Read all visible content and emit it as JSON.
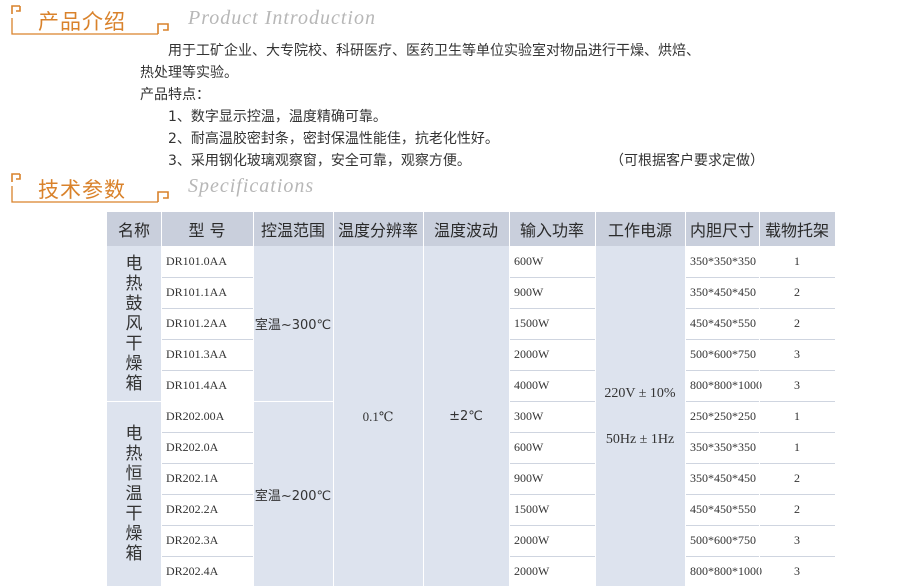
{
  "intro_section": {
    "title_cn": "产品介绍",
    "title_en": "Product Introduction",
    "lines": [
      "用于工矿企业、大专院校、科研医疗、医药卫生等单位实验室对物品进行干燥、烘焙、",
      "热处理等实验。",
      "产品特点：",
      "1、数字显示控温，温度精确可靠。",
      "2、耐高温胶密封条，密封保温性能佳，抗老化性好。",
      "3、采用钢化玻璃观察窗，安全可靠，观察方便。"
    ],
    "custom_note": "（可根据客户要求定做）"
  },
  "spec_section": {
    "title_cn": "技术参数",
    "title_en": "Specifications"
  },
  "table": {
    "headers": [
      "名称",
      "型 号",
      "控温范围",
      "温度分辨率",
      "温度波动",
      "输入功率",
      "工作电源",
      "内胆尺寸",
      "载物托架"
    ],
    "groups": [
      {
        "name": "电热鼓风干燥箱",
        "temp_range": "室温~300℃",
        "rows": [
          {
            "model": "DR101.0AA",
            "power": "600W",
            "size": "350*350*350",
            "trays": "1"
          },
          {
            "model": "DR101.1AA",
            "power": "900W",
            "size": "350*450*450",
            "trays": "2"
          },
          {
            "model": "DR101.2AA",
            "power": "1500W",
            "size": "450*450*550",
            "trays": "2"
          },
          {
            "model": "DR101.3AA",
            "power": "2000W",
            "size": "500*600*750",
            "trays": "3"
          },
          {
            "model": "DR101.4AA",
            "power": "4000W",
            "size": "800*800*1000",
            "trays": "3"
          }
        ]
      },
      {
        "name": "电热恒温干燥箱",
        "temp_range": "室温~200℃",
        "rows": [
          {
            "model": "DR202.00A",
            "power": "300W",
            "size": "250*250*250",
            "trays": "1"
          },
          {
            "model": "DR202.0A",
            "power": "600W",
            "size": "350*350*350",
            "trays": "1"
          },
          {
            "model": "DR202.1A",
            "power": "900W",
            "size": "350*450*450",
            "trays": "2"
          },
          {
            "model": "DR202.2A",
            "power": "1500W",
            "size": "450*450*550",
            "trays": "2"
          },
          {
            "model": "DR202.3A",
            "power": "2000W",
            "size": "500*600*750",
            "trays": "3"
          },
          {
            "model": "DR202.4A",
            "power": "2000W",
            "size": "800*800*1000",
            "trays": "3"
          }
        ]
      }
    ],
    "resolution": "0.1℃",
    "fluctuation": "±2℃",
    "power_supply_voltage": "220V ± 10%",
    "power_supply_frequency": "50Hz ± 1Hz"
  },
  "colors": {
    "heading_orange": "#d9822b",
    "heading_gray": "#b7b7b7",
    "table_header_bg": "#c9cfdc",
    "table_body_bg": "#dde3ee"
  }
}
